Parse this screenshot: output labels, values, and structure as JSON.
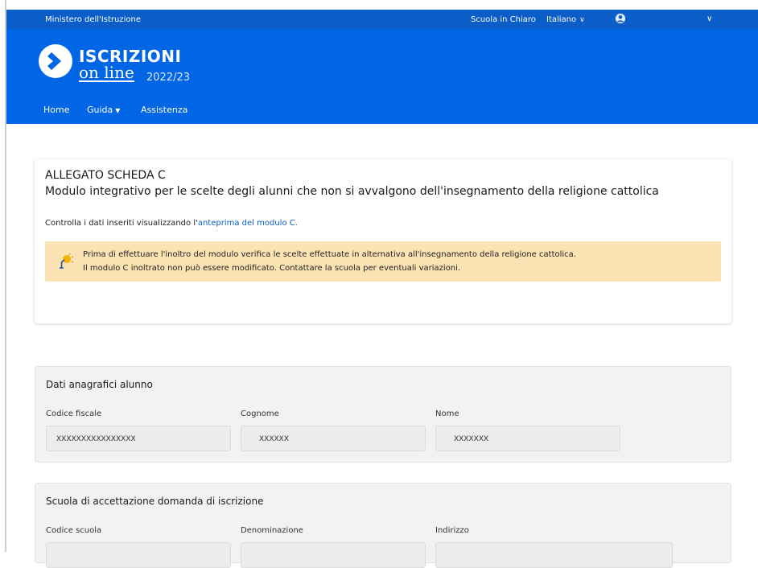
{
  "topbar": {
    "ministry": "Ministero dell'Istruzione",
    "scuola_in_chiaro": "Scuola in Chiaro",
    "language": "Italiano"
  },
  "brand": {
    "title": "ISCRIZIONI",
    "subtitle": "on line",
    "year": "2022/23"
  },
  "nav": {
    "home": "Home",
    "guida": "Guida",
    "assistenza": "Assistenza"
  },
  "card": {
    "title1": "ALLEGATO SCHEDA C",
    "title2": "Modulo integrativo per le scelte degli alunni che non si avvalgono dell'insegnamento della religione cattolica",
    "check_prefix": "Controlla i dati inseriti visualizzando l'",
    "check_link": "anteprima del modulo C.",
    "alert_line1": "Prima di effettuare l'inoltro del modulo verifica le scelte effettuate in alternativa all'insegnamento della religione cattolica.",
    "alert_line2": "Il modulo C inoltrato non può essere modificato. Contattare la scuola per eventuali variazioni."
  },
  "student": {
    "title": "Dati anagrafici alunno",
    "codice_fiscale_label": "Codice fiscale",
    "codice_fiscale_value": "XXXXXXXXXXXXXXXX",
    "cognome_label": "Cognome",
    "cognome_value": "XXXXXX",
    "nome_label": "Nome",
    "nome_value": "XXXXXXX"
  },
  "school": {
    "title": "Scuola di accettazione domanda di iscrizione",
    "codice_label": "Codice scuola",
    "denominazione_label": "Denominazione",
    "indirizzo_label": "Indirizzo"
  },
  "colors": {
    "primary": "#0066e6",
    "topbar": "#0b5dc8",
    "alert_bg": "#fce3b4",
    "section_bg": "#f2f2f2"
  }
}
